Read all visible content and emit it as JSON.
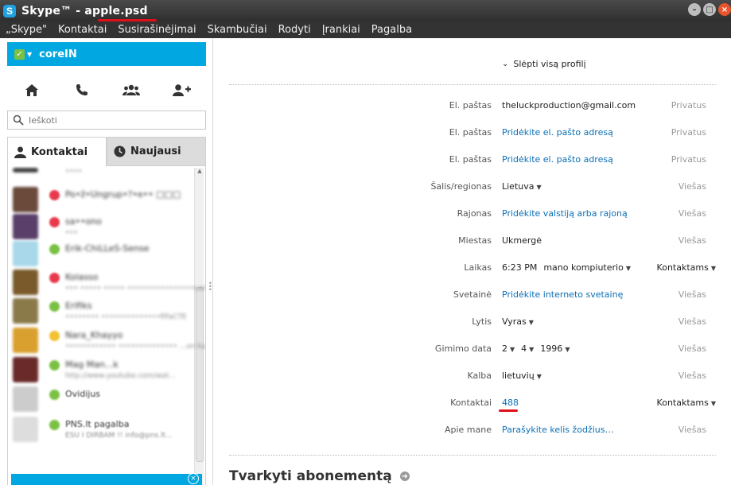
{
  "window": {
    "app_name": "Skype™ - ",
    "file_name": "apple.psd",
    "app_icon": "S",
    "controls": [
      "minimize",
      "maximize",
      "close"
    ]
  },
  "menu": [
    "„Skype\"",
    "Kontaktai",
    "Susirašinėjimai",
    "Skambučiai",
    "Rodyti",
    "Įrankiai",
    "Pagalba"
  ],
  "user": {
    "name": "coreIN",
    "status_color": "#7ac143"
  },
  "search": {
    "placeholder": "Ieškoti"
  },
  "tabs": {
    "contacts": "Kontaktai",
    "recent": "Naujausi"
  },
  "contacts": [
    {
      "name": "",
      "sub": "••••",
      "status": "",
      "avatar": "#444"
    },
    {
      "name": "Po•ž•Ungrup•?•e•• □□□",
      "sub": "",
      "status": "#e8394a",
      "avatar": "#6b4a3c"
    },
    {
      "name": "sa••ono",
      "sub": "•••",
      "status": "#e8394a",
      "avatar": "#5a3f6a"
    },
    {
      "name": "Erik-ChiLLeS-Sense",
      "sub": "",
      "status": "#7ac143",
      "avatar": "#a8d8ea"
    },
    {
      "name": "Kolasso",
      "sub": "••• ••••• ••••• ••••••••••••••••sam...",
      "status": "#e8394a",
      "avatar": "#7a5a2a"
    },
    {
      "name": "Erifiks",
      "sub": "•••••••• ••••••••••••••fiFaCTE",
      "status": "#7ac143",
      "avatar": "#8a7a4a"
    },
    {
      "name": "Nara_Khayyo",
      "sub": "•••••••••••• •••••••••••••• ...on kuna...",
      "status": "#f2c230",
      "avatar": "#d9a030"
    },
    {
      "name": "Mag Man...k",
      "sub": "http://www.youtube.com/wat...",
      "status": "#7ac143",
      "avatar": "#6a2a2a"
    },
    {
      "name": "Ovidijus",
      "sub": "",
      "status": "#7ac143",
      "avatar": "#cccccc"
    },
    {
      "name": "PNS.lt pagalba",
      "sub": "ESU I DIRBAM !! info@pns.lt...",
      "status": "#7ac143",
      "avatar": "#dddddd"
    }
  ],
  "profile": {
    "hide_label": "Slėpti visą profilį",
    "fields": [
      {
        "label": "El. paštas",
        "value": "theluckproduction@gmail.com",
        "link": false,
        "privacy": "Privatus"
      },
      {
        "label": "El. paštas",
        "value": "Pridėkite el. pašto adresą",
        "link": true,
        "privacy": "Privatus"
      },
      {
        "label": "El. paštas",
        "value": "Pridėkite el. pašto adresą",
        "link": true,
        "privacy": "Privatus"
      },
      {
        "label": "Šalis/regionas",
        "value": "Lietuva",
        "link": false,
        "dropdown": true,
        "privacy": "Viešas"
      },
      {
        "label": "Rajonas",
        "value": "Pridėkite valstiją arba rajoną",
        "link": true,
        "privacy": "Viešas"
      },
      {
        "label": "Miestas",
        "value": "Ukmergė",
        "link": false,
        "privacy": "Viešas"
      },
      {
        "label": "Laikas",
        "value": "6:23 PM",
        "extra": "mano kompiuterio",
        "link": false,
        "privacy": "Kontaktams",
        "privacy_dropdown": true
      },
      {
        "label": "Svetainė",
        "value": "Pridėkite interneto svetainę",
        "link": true,
        "privacy": "Viešas"
      },
      {
        "label": "Lytis",
        "value": "Vyras",
        "link": false,
        "dropdown": true,
        "privacy": "Viešas"
      },
      {
        "label": "Gimimo data",
        "value": "2",
        "day": "4",
        "year": "1996",
        "link": false,
        "dropdown": true,
        "privacy": "Viešas"
      },
      {
        "label": "Kalba",
        "value": "lietuvių",
        "link": false,
        "dropdown": true,
        "privacy": "Viešas"
      },
      {
        "label": "Kontaktai",
        "value": "488",
        "link": true,
        "privacy": "Kontaktams",
        "privacy_dropdown": true
      },
      {
        "label": "Apie mane",
        "value": "Parašykite kelis žodžius…",
        "link": true,
        "privacy": "Viešas"
      }
    ],
    "section_title": "Tvarkyti abonementą"
  }
}
